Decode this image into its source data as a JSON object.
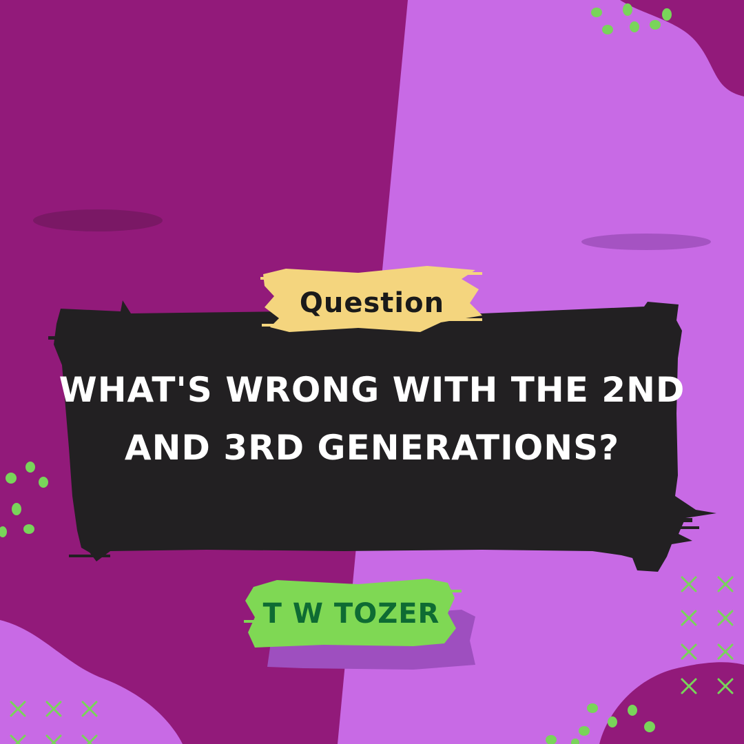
{
  "tag": {
    "label": "Question"
  },
  "question": {
    "line1": "WHAT'S WRONG WITH THE 2ND",
    "line2": "AND 3RD GENERATIONS?"
  },
  "author": {
    "label": "T W TOZER"
  },
  "colors": {
    "left_panel": "#921a7a",
    "right_panel": "#c86ae5",
    "banner": "#222022",
    "tag_brush": "#f4d57e",
    "author_brush": "#7fd854",
    "author_text": "#0e6b33",
    "accent_dots": "#79d45a"
  }
}
